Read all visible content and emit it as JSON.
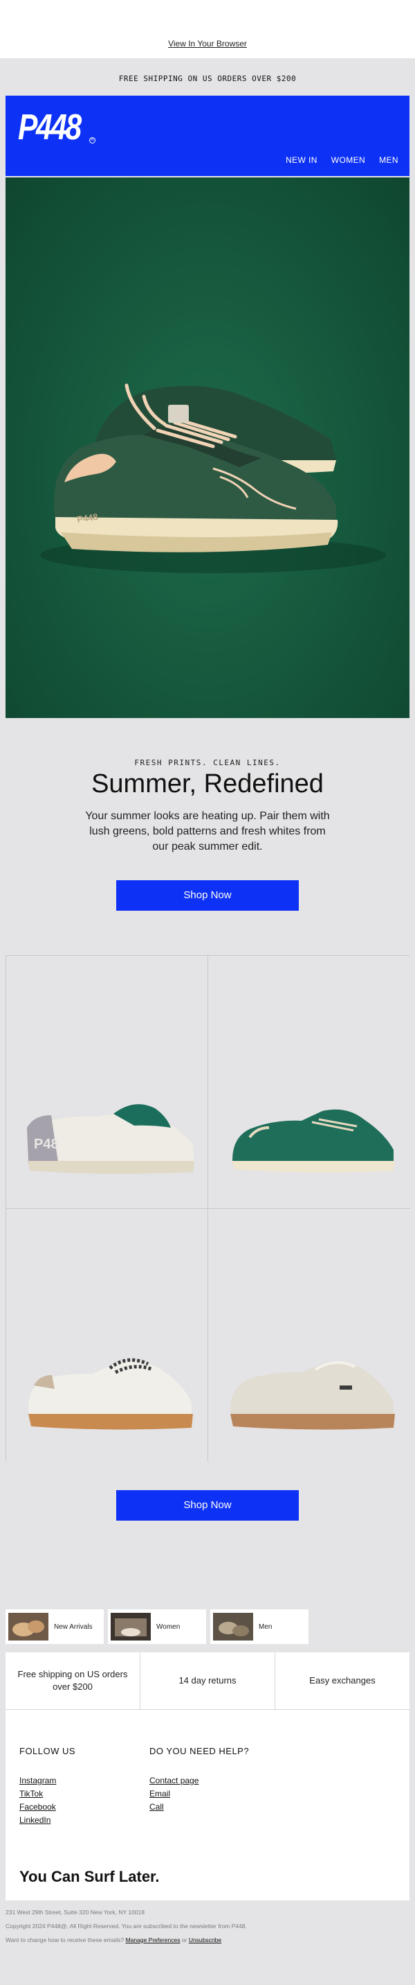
{
  "preheader": {
    "view_in_browser": "View In Your Browser"
  },
  "announcement": {
    "text": "FREE SHIPPING ON US ORDERS OVER $200"
  },
  "header": {
    "logo": "P448",
    "nav": [
      {
        "label": "NEW IN"
      },
      {
        "label": "WOMEN"
      },
      {
        "label": "MEN"
      }
    ],
    "brand_color": "#0e32f5"
  },
  "hero": {
    "background_color": "#15573c",
    "image": "green-suede-sneaker"
  },
  "intro": {
    "eyebrow": "FRESH PRINTS. CLEAN LINES.",
    "headline": "Summer, Redefined",
    "body": "Your summer looks are heating up. Pair them with lush greens, bold patterns and fresh whites from our peak summer edit.",
    "cta": "Shop Now"
  },
  "products": [
    {
      "image": "white-sneaker-gray-heel"
    },
    {
      "image": "green-suede-sneaker"
    },
    {
      "image": "white-sneaker-leopard-laces"
    },
    {
      "image": "cream-suede-sneaker"
    }
  ],
  "products_cta": "Shop Now",
  "categories": [
    {
      "label": "New Arrivals"
    },
    {
      "label": "Women"
    },
    {
      "label": "Men"
    }
  ],
  "features": [
    {
      "text": "Free shipping on US orders over $200"
    },
    {
      "text": "14 day returns"
    },
    {
      "text": "Easy exchanges"
    }
  ],
  "footer": {
    "follow": {
      "title": "FOLLOW US",
      "links": [
        "Instagram",
        "TikTok",
        "Facebook",
        "LinkedIn"
      ]
    },
    "help": {
      "title": "DO YOU NEED HELP?",
      "links": [
        "Contact page",
        "Email",
        "Call"
      ]
    },
    "tagline": "You Can Surf Later."
  },
  "legal": {
    "address": "231 West 29th Street, Suite 320 New York, NY 10018",
    "copyright": "Copyright 2024 P448@, All Right Reserved. You are subscribed to the newsletter from P448.",
    "prefs_prefix": "Want to change how to receive these emails?",
    "manage": "Manage Preferences",
    "or": "or",
    "unsubscribe": "Unsubscribe"
  }
}
